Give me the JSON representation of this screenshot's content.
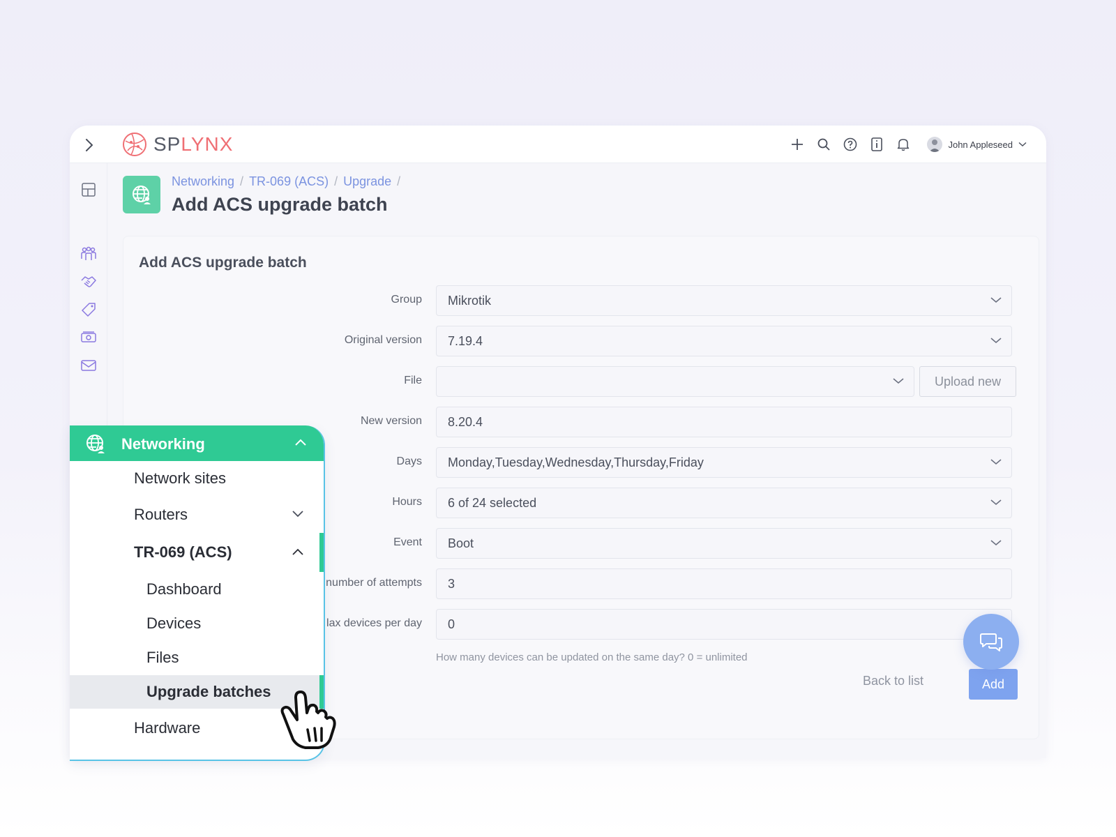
{
  "app": {
    "logo_prefix": "SP",
    "logo_suffix": "LYNX",
    "user_name": "John Appleseed"
  },
  "breadcrumb": {
    "items": [
      "Networking",
      "TR-069 (ACS)",
      "Upgrade"
    ],
    "separator": "/"
  },
  "page": {
    "title": "Add ACS upgrade batch"
  },
  "form": {
    "title": "Add ACS upgrade batch",
    "group_label": "Group",
    "group_value": "Mikrotik",
    "original_version_label": "Original version",
    "original_version_value": "7.19.4",
    "file_label": "File",
    "file_value": "",
    "upload_label": "Upload new",
    "new_version_label": "New version",
    "new_version_value": "8.20.4",
    "days_label": "Days",
    "days_value": "Monday,Tuesday,Wednesday,Thursday,Friday",
    "hours_label": "Hours",
    "hours_value": "6 of 24 selected",
    "event_label": "Event",
    "event_value": "Boot",
    "attempts_label": "number of attempts",
    "attempts_value": "3",
    "max_devices_label": "lax devices per day",
    "max_devices_value": "0",
    "max_devices_hint": "How many devices can be updated on the same day? 0 = unlimited",
    "back_label": "Back to list",
    "add_label": "Add"
  },
  "menu": {
    "header": "Networking",
    "items": [
      {
        "label": "Network sites"
      },
      {
        "label": "Routers"
      },
      {
        "label": "TR-069 (ACS)"
      },
      {
        "label": "Dashboard"
      },
      {
        "label": "Devices"
      },
      {
        "label": "Files"
      },
      {
        "label": "Upgrade batches"
      },
      {
        "label": "Hardware"
      }
    ]
  },
  "colors": {
    "accent_green": "#2fca94",
    "accent_blue": "#7ea3ef",
    "link_blue": "#7b93e0",
    "logo_red": "#ef6f74"
  }
}
